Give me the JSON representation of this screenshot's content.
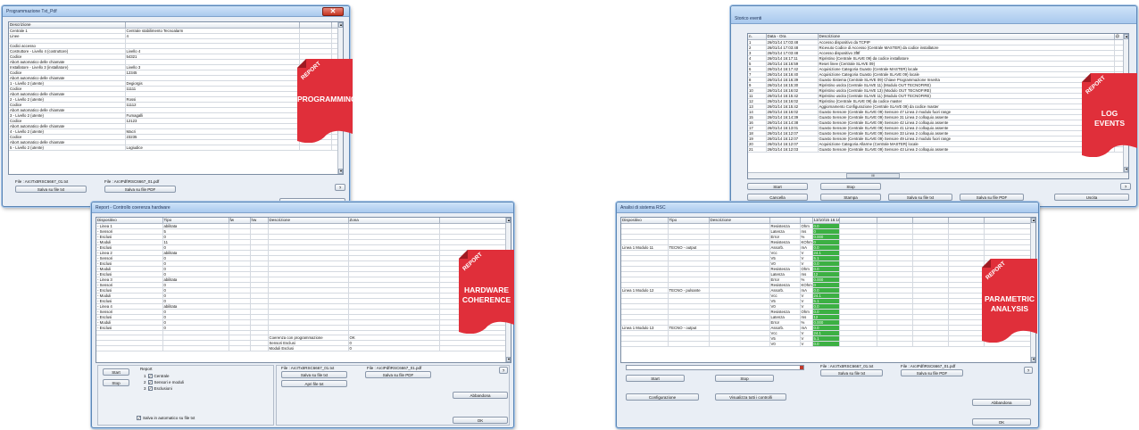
{
  "windows": {
    "programming": {
      "title": "Programmazione Txt_Pdf",
      "col_header": "Descrizione",
      "rows": [
        [
          "Centrale 1",
          "Centrale stabilimento Tecnoalarm"
        ],
        [
          "  Linee",
          "4"
        ],
        [
          "",
          ""
        ],
        [
          "Codici accesso",
          ""
        ],
        [
          "  Costruttore - Livello 4 (costruttore)",
          "Livello 4"
        ],
        [
          "    Codice",
          "54321"
        ],
        [
          "    Abort automatico delle chiamate",
          ""
        ],
        [
          "  Installatore - Livello 3 (installatore)",
          "Livello 3"
        ],
        [
          "    Codice",
          "12345"
        ],
        [
          "    Abort automatico delle chiamate",
          ""
        ],
        [
          "  1 - Livello 2 (utente)",
          "Degiorgis"
        ],
        [
          "    Codice",
          "11111"
        ],
        [
          "    Abort automatico delle chiamate",
          ""
        ],
        [
          "  2 - Livello 2 (utente)",
          "Rossi"
        ],
        [
          "    Codice",
          "11112"
        ],
        [
          "    Abort automatico delle chiamate",
          ""
        ],
        [
          "  3 - Livello 2 (utente)",
          "Fumagalli"
        ],
        [
          "    Codice",
          "12123"
        ],
        [
          "    Abort automatico delle chiamate",
          ""
        ],
        [
          "  4 - Livello 2 (utente)",
          "Macri"
        ],
        [
          "    Codice",
          "23235"
        ],
        [
          "    Abort automatico delle chiamate",
          ""
        ],
        [
          "  5 - Livello 2 (utente)",
          "Logiudice"
        ]
      ],
      "file_txt": "File : ArcITxtIRSC6667_01.txt",
      "file_pdf": "File : ArcIPdfIRSC6667_01.pdf",
      "btn_save_txt": "Salva su file txt",
      "btn_save_pdf": "Salva su file PDF",
      "btn_help": "?",
      "btn_ok": "OK"
    },
    "log": {
      "title": "Storico eventi",
      "headers": [
        "n.",
        "Data - Ora",
        "Descrizione",
        "@"
      ],
      "rows": [
        [
          "1",
          "26/01/14 17:03:48",
          "Accesso dispositivo da TCPIP"
        ],
        [
          "2",
          "26/01/14 17:03:48",
          "Ricevuto Codice di Accesso (Centrale MASTER) da codice installatore"
        ],
        [
          "3",
          "26/01/14 17:03:48",
          "Accesso dispositivo 3f8f"
        ],
        [
          "4",
          "26/01/14 16:17:11",
          "Ripristino (Centrale SLAVE 09) da codice installatore"
        ],
        [
          "5",
          "26/01/14 16:16:59",
          "Reset linee (Centrale SLAVE 09)"
        ],
        [
          "6",
          "26/01/14 16:17:42",
          "Acquisizione Categoria Guasto (Centrale MASTER) locale"
        ],
        [
          "7",
          "26/01/14 16:16:40",
          "Acquisizione Categoria Guasto (Centrale SLAVE 09) locale"
        ],
        [
          "8",
          "26/01/14 16:16:39",
          "Guasto Sistema (Centrale SLAVE 09) Chiave Programmazione Inserita"
        ],
        [
          "9",
          "26/01/14 16:15:30",
          "Ripristino uscita (Centrale SLAVE 11) (Modulo OUT TECNOFIRE)"
        ],
        [
          "10",
          "26/01/14 16:16:02",
          "Ripristino uscita (Centrale SLAVE 13) (Modulo OUT TECNOFIRE)"
        ],
        [
          "11",
          "26/01/14 16:15:42",
          "Ripristino uscita (Centrale SLAVE 11) (Modulo OUT TECNOFIRE)"
        ],
        [
          "12",
          "26/01/14 16:16:02",
          "Ripristino (Centrale SLAVE 09) da codice master"
        ],
        [
          "13",
          "26/01/14 16:15:42",
          "Aggiornamento Configurazione (Centrale SLAVE 09) da codice master"
        ],
        [
          "14",
          "26/01/14 16:16:02",
          "Guasto Sensore (Centrale SLAVE 09) Sensore 47 Linea 2 modulo fuori range"
        ],
        [
          "15",
          "26/01/14 16:14:39",
          "Guasto Sensore (Centrale SLAVE 09) Sensore 31 Linea 2 colloquio assente"
        ],
        [
          "16",
          "26/01/14 16:14:38",
          "Guasto Sensore (Centrale SLAVE 09) Sensore 42 Linea 2 colloquio assente"
        ],
        [
          "17",
          "26/01/14 16:13:01",
          "Guasto Sensore (Centrale SLAVE 09) Sensore 41 Linea 2 colloquio assente"
        ],
        [
          "18",
          "26/01/14 16:12:07",
          "Guasto Sensore (Centrale SLAVE 09) Sensore 33 Linea 2 colloquio assente"
        ],
        [
          "19",
          "26/01/14 16:12:07",
          "Guasto Sensore (Centrale SLAVE 09) Sensore 49 Linea 2 modulo fuori range"
        ],
        [
          "20",
          "26/01/14 16:12:07",
          "Acquisizione Categoria Allarme (Centrale MASTER) locale"
        ],
        [
          "21",
          "26/01/14 16:12:03",
          "Guasto Sensore (Centrale SLAVE 09) Sensore 43 Linea 2 colloquio assente"
        ]
      ],
      "scroll_label": "III",
      "btn_start": "Start",
      "btn_stop": "Stop",
      "btn_cancel": "Cancella",
      "btn_print": "Stampa",
      "btn_save_txt": "Salva su file txt",
      "btn_save_pdf": "Salva su file PDF",
      "btn_exit": "Uscita",
      "btn_help": "?"
    },
    "hardware": {
      "title": "Report - Controllo coerenza hardware",
      "headers": [
        "Dispositivo",
        "Tipo",
        "fw",
        "hw",
        "Descrizione",
        "Zona"
      ],
      "rows": [
        [
          "- Linea 1",
          "abilitata",
          "",
          "",
          "",
          ""
        ],
        [
          "  - Sensori",
          "5",
          "",
          "",
          "",
          ""
        ],
        [
          "    - Esclusi",
          "0",
          "",
          "",
          "",
          ""
        ],
        [
          "  - Moduli",
          "11",
          "",
          "",
          "",
          ""
        ],
        [
          "    - Esclusi",
          "0",
          "",
          "",
          "",
          ""
        ],
        [
          "- Linea 2",
          "abilitata",
          "",
          "",
          "",
          ""
        ],
        [
          "  - Sensori",
          "0",
          "",
          "",
          "",
          ""
        ],
        [
          "    - Esclusi",
          "0",
          "",
          "",
          "",
          ""
        ],
        [
          "  - Moduli",
          "0",
          "",
          "",
          "",
          ""
        ],
        [
          "    - Esclusi",
          "0",
          "",
          "",
          "",
          ""
        ],
        [
          "- Linea 3",
          "abilitata",
          "",
          "",
          "",
          ""
        ],
        [
          "  - Sensori",
          "0",
          "",
          "",
          "",
          ""
        ],
        [
          "    - Esclusi",
          "0",
          "",
          "",
          "",
          ""
        ],
        [
          "  - Moduli",
          "0",
          "",
          "",
          "",
          ""
        ],
        [
          "    - Esclusi",
          "0",
          "",
          "",
          "",
          ""
        ],
        [
          "- Linea 4",
          "abilitata",
          "",
          "",
          "",
          ""
        ],
        [
          "  - Sensori",
          "0",
          "",
          "",
          "",
          ""
        ],
        [
          "    - Esclusi",
          "0",
          "",
          "",
          "",
          ""
        ],
        [
          "  - Moduli",
          "0",
          "",
          "",
          "",
          ""
        ],
        [
          "    - Esclusi",
          "0",
          "",
          "",
          "",
          ""
        ],
        [
          "",
          "",
          "",
          "",
          "",
          ""
        ],
        [
          "",
          "",
          "",
          "",
          "Coerenza con programmazione",
          "OK"
        ],
        [
          "",
          "",
          "",
          "",
          "Sensori Esclusi",
          "0"
        ],
        [
          "",
          "",
          "",
          "",
          "Moduli Esclusi",
          "0"
        ]
      ],
      "btn_start": "Start",
      "btn_stop": "Stop",
      "report_label": "Report",
      "checks": [
        {
          "n": "1",
          "label": "Centrale"
        },
        {
          "n": "2",
          "label": "Sensori e moduli"
        },
        {
          "n": "3",
          "label": "Esclusioni"
        }
      ],
      "file_txt": "File : ArcITxtIRSC6667_01.txt",
      "file_pdf": "File : ArcIPdfIRSC6667_01.pdf",
      "btn_save_txt": "Salva su file txt",
      "btn_open_txt": "Apri file txt",
      "btn_save_pdf": "Salva su file PDF",
      "btn_help": "?",
      "btn_abandon": "Abbandona",
      "btn_ok": "OK",
      "auto_save": "Salva in automatico su file txt"
    },
    "parametric": {
      "title": "Analisi di sistema RSC",
      "headers": [
        "Dispositivo",
        "Tipo",
        "Descrizione",
        "",
        "",
        "13/10/15 16:16"
      ],
      "rows": [
        [
          "",
          "",
          "",
          "Resistenza",
          "Ohm",
          "0.0"
        ],
        [
          "",
          "",
          "",
          "Latenza",
          "ms",
          "0"
        ],
        [
          "",
          "",
          "",
          "Error",
          "%",
          "0.000"
        ],
        [
          "",
          "",
          "",
          "Resistenza",
          "KOhm",
          "0"
        ],
        [
          "Linea 1 Modulo 11",
          "TECNO - output",
          "",
          "Assorb.",
          "mA",
          "0.0"
        ],
        [
          "",
          "",
          "",
          "Vcc",
          "V",
          "24.1"
        ],
        [
          "",
          "",
          "",
          "V5",
          "V",
          "5.1"
        ],
        [
          "",
          "",
          "",
          "V0",
          "V",
          "0.0"
        ],
        [
          "",
          "",
          "",
          "Resistenza",
          "Ohm",
          "0.0"
        ],
        [
          "",
          "",
          "",
          "Latenza",
          "ms",
          "12"
        ],
        [
          "",
          "",
          "",
          "Error",
          "%",
          "0.000"
        ],
        [
          "",
          "",
          "",
          "Resistenza",
          "KOhm",
          "0"
        ],
        [
          "Linea 1 Modulo 12",
          "TECNO - pulsante",
          "",
          "Assorb.",
          "mA",
          "0.0"
        ],
        [
          "",
          "",
          "",
          "Vcc",
          "V",
          "24.1"
        ],
        [
          "",
          "",
          "",
          "V5",
          "V",
          "5.1"
        ],
        [
          "",
          "",
          "",
          "V0",
          "V",
          "0.0"
        ],
        [
          "",
          "",
          "",
          "Resistenza",
          "Ohm",
          "0.0"
        ],
        [
          "",
          "",
          "",
          "Latenza",
          "ms",
          "12"
        ],
        [
          "",
          "",
          "",
          "Error",
          "%",
          "0.000"
        ],
        [
          "Linea 1 Modulo 13",
          "TECNO - output",
          "",
          "Assorb.",
          "mA",
          "0.0"
        ],
        [
          "",
          "",
          "",
          "Vcc",
          "V",
          "24.1"
        ],
        [
          "",
          "",
          "",
          "V5",
          "V",
          "5.1"
        ],
        [
          "",
          "",
          "",
          "V0",
          "V",
          "0.0"
        ]
      ],
      "btn_start": "Start",
      "btn_stop": "Stop",
      "btn_config": "Configurazione",
      "btn_view_all": "Visualizza tutti i controlli",
      "file_txt": "File : ArcITxtIRSC6667_01.txt",
      "file_pdf": "File : ArcIPdfIRSC6667_01.pdf",
      "btn_save_txt": "Salva su file txt",
      "btn_save_pdf": "Salva su file PDF",
      "btn_help": "?",
      "btn_abandon": "Abbandona",
      "btn_ok": "OK"
    }
  },
  "badges": {
    "report_word": "REPORT",
    "programming": "PROGRAMMING",
    "log_line1": "LOG",
    "log_line2": "EVENTS",
    "hardware_line1": "HARDWARE",
    "hardware_line2": "COHERENCE",
    "parametric_line1": "PARAMETRIC",
    "parametric_line2": "ANALYSIS",
    "color": "#e02f3a"
  }
}
